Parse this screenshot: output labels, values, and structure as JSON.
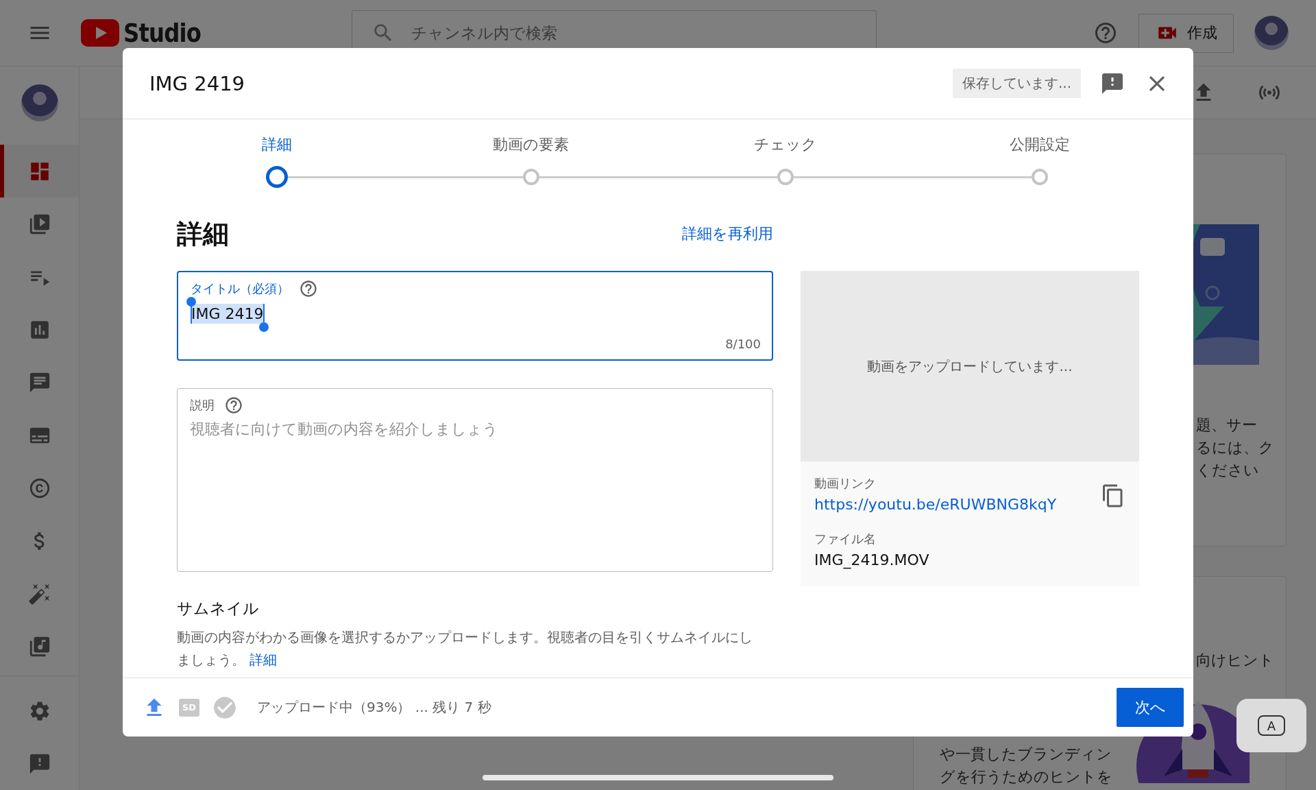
{
  "topbar": {
    "logo_text": "Studio",
    "search_placeholder": "チャンネル内で検索",
    "create_label": "作成"
  },
  "sidebar": {
    "items": [
      {
        "kind": "dashboard",
        "selected": true
      },
      {
        "kind": "videos",
        "selected": false
      },
      {
        "kind": "playlists",
        "selected": false
      },
      {
        "kind": "analytics",
        "selected": false
      },
      {
        "kind": "comments",
        "selected": false
      },
      {
        "kind": "subtitles",
        "selected": false
      },
      {
        "kind": "copyright",
        "selected": false
      },
      {
        "kind": "earn",
        "selected": false
      },
      {
        "kind": "customize",
        "selected": false
      },
      {
        "kind": "audio",
        "selected": false
      }
    ],
    "bottom_items": [
      {
        "kind": "settings",
        "selected": false
      },
      {
        "kind": "feedback",
        "selected": false
      }
    ]
  },
  "background": {
    "card_1_lines": [
      "題、サー",
      "るには、ク",
      "ください"
    ],
    "card_2_heading": "向けヒント",
    "card_2_lines": [
      "や一貫したブランディン",
      "グを行うためのヒントを"
    ]
  },
  "dialog": {
    "title": "IMG 2419",
    "save_status": "保存しています...",
    "steps": [
      {
        "label": "詳細",
        "selected": true
      },
      {
        "label": "動画の要素",
        "selected": false
      },
      {
        "label": "チェック",
        "selected": false
      },
      {
        "label": "公開設定",
        "selected": false
      }
    ],
    "heading": "詳細",
    "reuse_link": "詳細を再利用",
    "title_field": {
      "label": "タイトル（必須）",
      "value": "IMG 2419",
      "text_selected": true,
      "counter": "8/100"
    },
    "description_field": {
      "label": "説明",
      "placeholder": "視聴者に向けて動画の内容を紹介しましょう"
    },
    "preview": {
      "status": "動画をアップロードしています...",
      "link_label": "動画リンク",
      "link": "https://youtu.be/eRUWBNG8kqY",
      "file_label": "ファイル名",
      "file_name": "IMG_2419.MOV"
    },
    "thumbnail": {
      "heading": "サムネイル",
      "description": "動画の内容がわかる画像を選択するかアップロードします。視聴者の目を引くサムネイルにしましょう。",
      "link": "詳細"
    },
    "footer": {
      "sd_badge": "SD",
      "status": "アップロード中（93%） ... 残り 7 秒",
      "next_label": "次へ"
    }
  },
  "keyboard_button": {
    "label": "A"
  }
}
